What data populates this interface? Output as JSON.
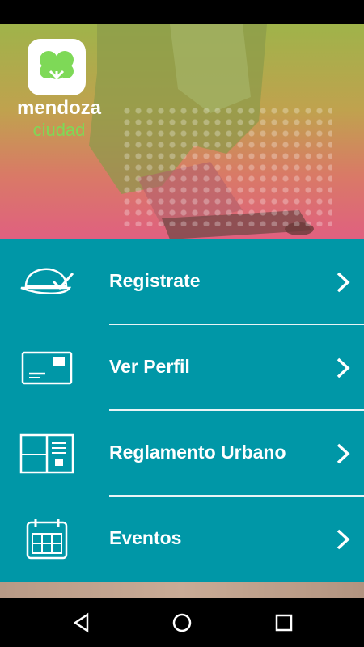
{
  "logo": {
    "name": "mendoza",
    "sub": "ciudad"
  },
  "menu": {
    "items": [
      {
        "label": "Registrate",
        "icon": "cap-check-icon"
      },
      {
        "label": "Ver Perfil",
        "icon": "id-card-icon"
      },
      {
        "label": "Reglamento Urbano",
        "icon": "book-icon"
      },
      {
        "label": "Eventos",
        "icon": "calendar-icon"
      }
    ]
  },
  "colors": {
    "menu_bg": "#0097a7",
    "text": "#ffffff",
    "logo_green": "#7ed957"
  },
  "nav": {
    "back": "back-icon",
    "home": "home-icon",
    "recents": "recents-icon"
  }
}
